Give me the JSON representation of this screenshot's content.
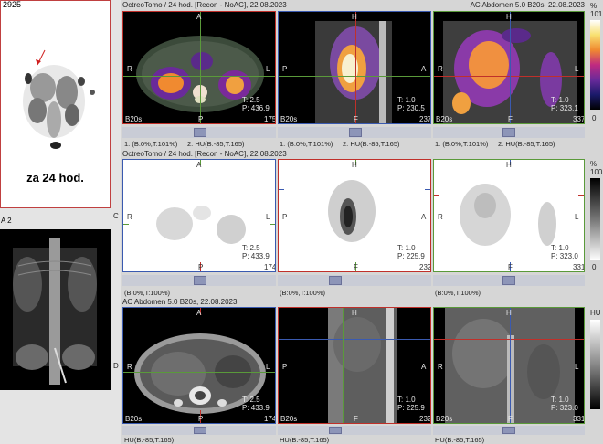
{
  "left": {
    "mip_number": "2925",
    "mip_caption": "za 24 hod.",
    "label2": "A 2"
  },
  "row1": {
    "title_left": "OctreoTomo / 24  hod. [Recon - NoAC], 22.08.2023",
    "title_right": "AC  Abdomen  5.0  B20s, 22.08.2023",
    "views": [
      {
        "top": "A",
        "left": "R",
        "right": "L",
        "bottom": "P",
        "t": "T: 2.5",
        "p": "P: 436.9",
        "slice": "175",
        "corner": "B20s"
      },
      {
        "top": "H",
        "left": "P",
        "right": "A",
        "bottom": "F",
        "t": "T: 1.0",
        "p": "P: 230.5",
        "slice": "237",
        "corner": "B20s"
      },
      {
        "top": "H",
        "left": "R",
        "right": "L",
        "bottom": "F",
        "t": "T: 1.0",
        "p": "P: 323.1",
        "slice": "337",
        "corner": "B20s"
      }
    ],
    "sub": [
      "1: (B:0%,T:101%)",
      "2: HU(B:-85,T:165)",
      "1: (B:0%,T:101%)",
      "2: HU(B:-85,T:165)",
      "1: (B:0%,T:101%)",
      "2: HU(B:-85,T:165)"
    ],
    "bar_top": "101",
    "bar_bottom": "0",
    "bar_unit": "%"
  },
  "row2": {
    "title": "OctreoTomo / 24  hod. [Recon - NoAC], 22.08.2023",
    "views": [
      {
        "top": "A",
        "left": "R",
        "right": "L",
        "bottom": "P",
        "t": "T: 2.5",
        "p": "P: 433.9",
        "slice": "174"
      },
      {
        "top": "H",
        "left": "P",
        "right": "A",
        "bottom": "F",
        "t": "T: 1.0",
        "p": "P: 225.9",
        "slice": "232"
      },
      {
        "top": "H",
        "left": "R",
        "right": "L",
        "bottom": "F",
        "t": "T: 1.0",
        "p": "P: 323.0",
        "slice": "331"
      }
    ],
    "sub": [
      "(B:0%,T:100%)",
      "(B:0%,T:100%)",
      "(B:0%,T:100%)"
    ],
    "bar_top": "100",
    "bar_bottom": "0",
    "bar_unit": "%",
    "side_left": "C"
  },
  "row3": {
    "title": "AC  Abdomen  5.0  B20s, 22.08.2023",
    "views": [
      {
        "top": "A",
        "left": "R",
        "right": "L",
        "bottom": "P",
        "t": "T: 2.5",
        "p": "P: 433.9",
        "slice": "174",
        "corner": "B20s"
      },
      {
        "top": "H",
        "left": "P",
        "right": "A",
        "bottom": "F",
        "t": "T: 1.0",
        "p": "P: 225.9",
        "slice": "232",
        "corner": "B20s"
      },
      {
        "top": "H",
        "left": "R",
        "right": "L",
        "bottom": "F",
        "t": "T: 1.0",
        "p": "P: 323.0",
        "slice": "331",
        "corner": "B20s"
      }
    ],
    "sub": [
      "HU(B:-85,T:165)",
      "HU(B:-85,T:165)",
      "HU(B:-85,T:165)"
    ],
    "bar_unit": "HU",
    "side_left": "D"
  },
  "colors": {
    "frame_red": "#c0302a",
    "frame_green": "#5a9a3a",
    "frame_blue": "#3a5ab0",
    "slider_thumb": "#8d95b8"
  }
}
